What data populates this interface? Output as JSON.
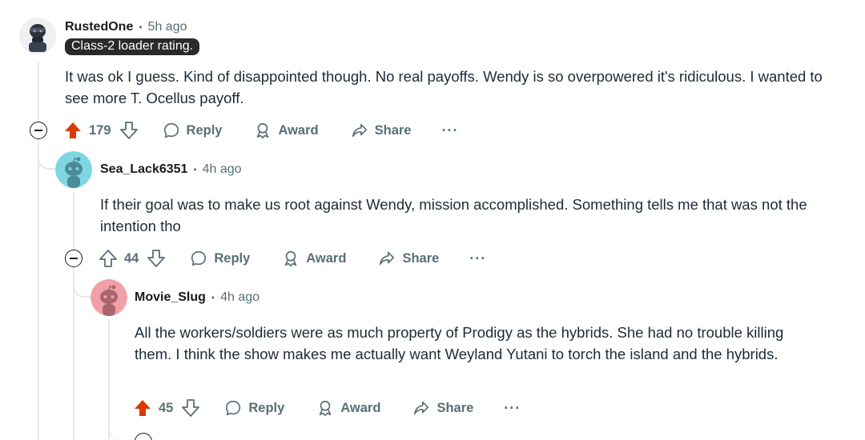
{
  "comments": [
    {
      "author": "RustedOne",
      "time": "5h ago",
      "flair": "Class-2 loader rating.",
      "body": "It was ok I guess. Kind of disappointed though. No real payoffs. Wendy is so overpowered it's ridiculous. I wanted to see more T. Ocellus payoff.",
      "score": "179",
      "upvoted": true
    },
    {
      "author": "Sea_Lack6351",
      "time": "4h ago",
      "body": "If their goal was to make us root against Wendy, mission accomplished. Something tells me that was not the intention tho",
      "score": "44",
      "upvoted": false
    },
    {
      "author": "Movie_Slug",
      "time": "4h ago",
      "body": "All the workers/soldiers were as much property of Prodigy as the hybrids.  She had no trouble killing them.  I think the show makes me actually want Weyland Yutani to torch the island and the hybrids.",
      "score": "45",
      "upvoted": true
    }
  ],
  "actions": {
    "reply": "Reply",
    "award": "Award",
    "share": "Share",
    "more": "···"
  },
  "separator": "•",
  "colors": {
    "upvote_active": "#d93a00",
    "muted_text": "#576f76",
    "flair_bg": "#2a2a2a",
    "avatar_teal": "#7fd6e3",
    "avatar_pink": "#f2a0a8"
  }
}
